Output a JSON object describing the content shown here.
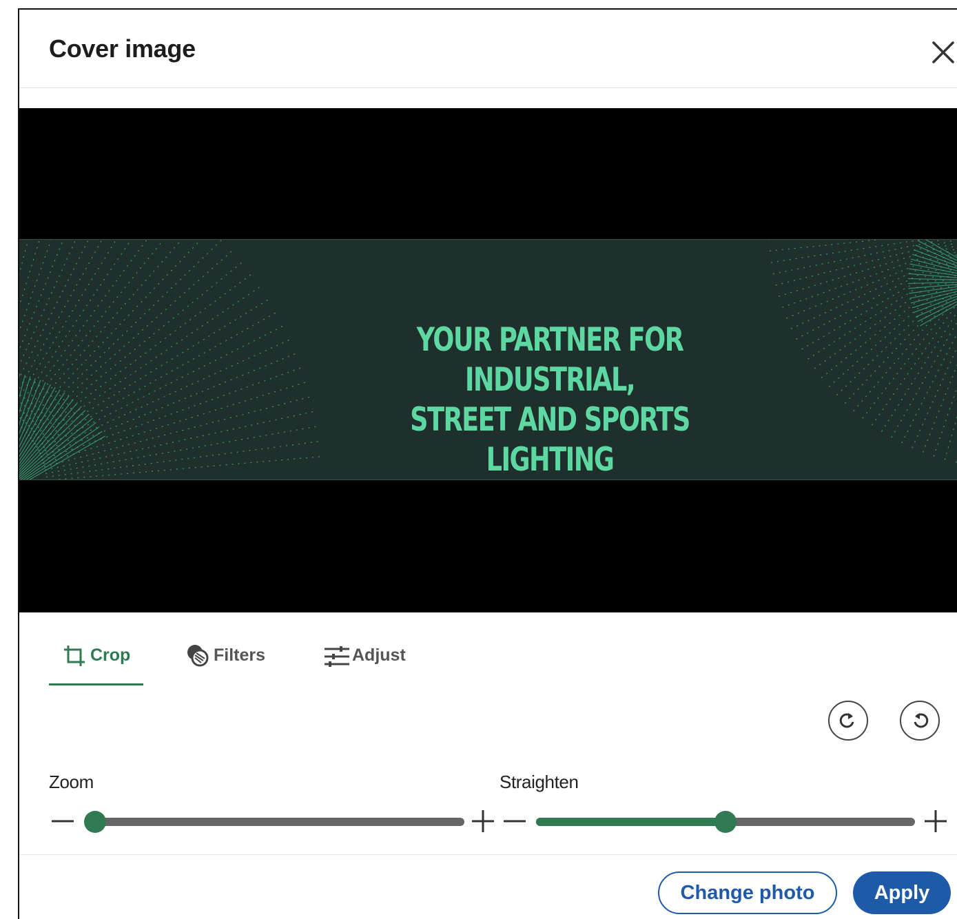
{
  "dialog": {
    "title": "Cover image"
  },
  "banner": {
    "line1": "YOUR PARTNER FOR INDUSTRIAL,",
    "line2": "STREET AND SPORTS LIGHTING",
    "text_color": "#5ed8a2",
    "background": "#1f2f2b"
  },
  "tabs": [
    {
      "label": "Crop",
      "icon": "crop-icon",
      "active": true
    },
    {
      "label": "Filters",
      "icon": "filters-icon",
      "active": false
    },
    {
      "label": "Adjust",
      "icon": "sliders-icon",
      "active": false
    }
  ],
  "rotate": {
    "left_icon": "rotate-clockwise-icon",
    "right_icon": "rotate-counterclockwise-icon"
  },
  "zoom": {
    "label": "Zoom",
    "value": 0.0
  },
  "straighten": {
    "label": "Straighten",
    "value": 0.5
  },
  "footer": {
    "change_photo": "Change photo",
    "apply": "Apply"
  },
  "colors": {
    "accent": "#2f7a52",
    "primary": "#1e5aa8"
  }
}
